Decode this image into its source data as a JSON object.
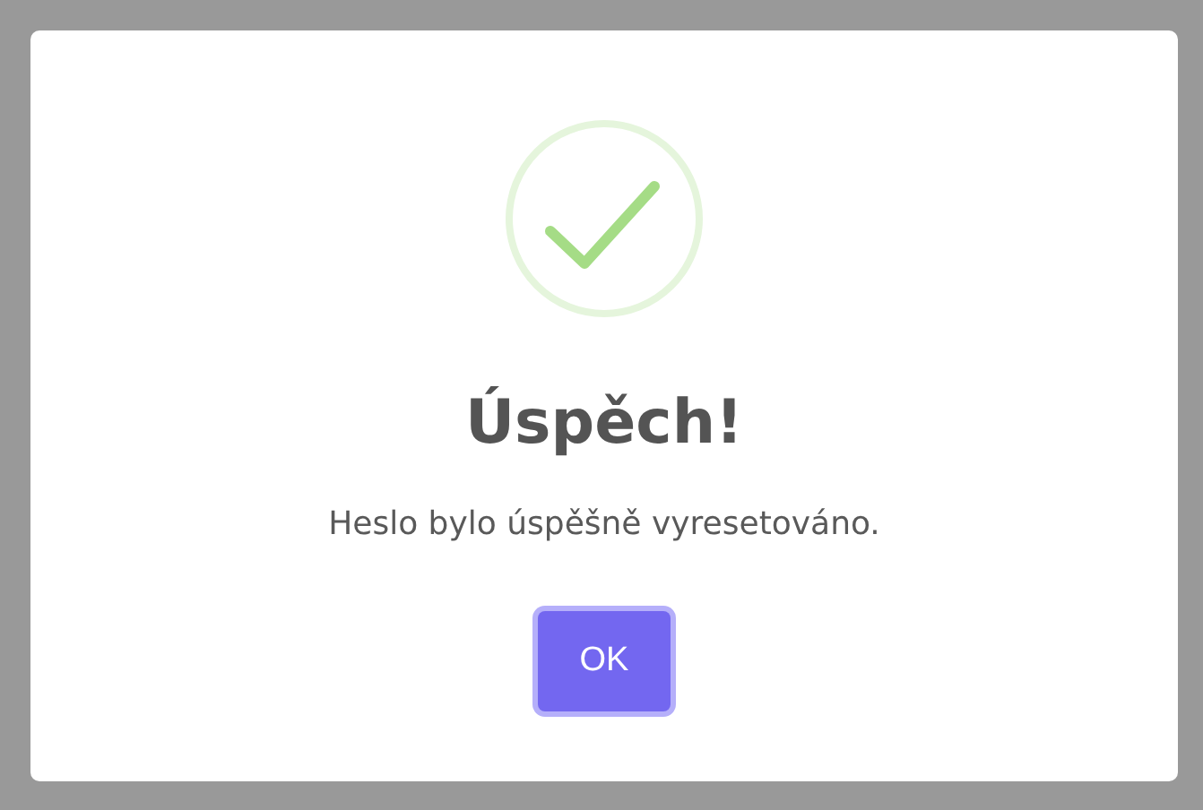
{
  "dialog": {
    "kind": "success",
    "title": "Úspěch!",
    "message": "Heslo bylo úspěšně vyresetováno.",
    "buttons": [
      {
        "label": "OK",
        "focused": true
      }
    ]
  }
}
